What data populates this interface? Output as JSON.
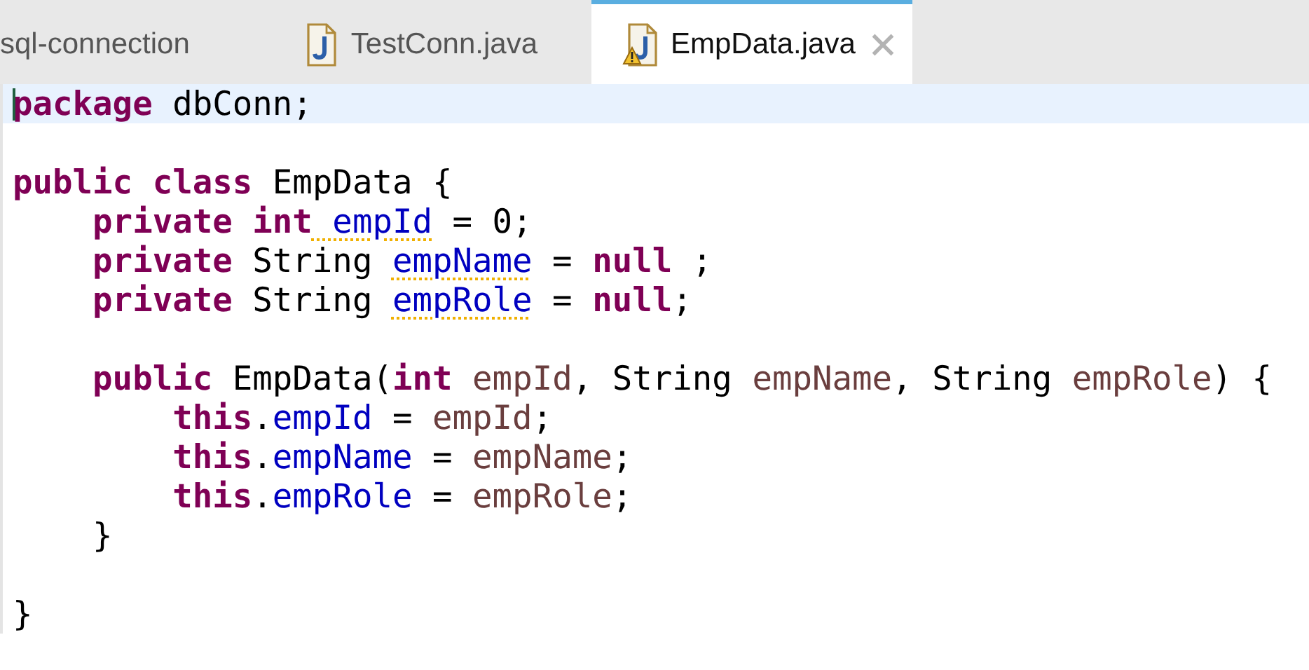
{
  "tabs": [
    {
      "label": "sql-connection",
      "kind": "project",
      "selected": false
    },
    {
      "label": "TestConn.java",
      "kind": "java",
      "selected": false,
      "warning": false
    },
    {
      "label": "EmpData.java",
      "kind": "java",
      "selected": true,
      "warning": true
    }
  ],
  "editor": {
    "lines": [
      {
        "current": true,
        "tokens": [
          {
            "text": "package",
            "kind": "keyword"
          },
          {
            "text": " dbConn;",
            "kind": "plain"
          }
        ]
      },
      {
        "current": false
      },
      {
        "current": false,
        "tokens": [
          {
            "text": "public",
            "kind": "keyword"
          },
          {
            "text": " class",
            "kind": "keyword"
          },
          {
            "text": " EmpData {",
            "kind": "plain"
          }
        ]
      },
      {
        "current": false,
        "tokens": [
          {
            "text": "    private",
            "kind": "keyword"
          },
          {
            "text": " int",
            "kind": "keyword"
          },
          {
            "text": " empId",
            "kind": "field",
            "warning": true
          },
          {
            "text": " = 0;",
            "kind": "plain"
          }
        ]
      },
      {
        "current": false,
        "tokens": [
          {
            "text": "    private",
            "kind": "keyword"
          },
          {
            "text": " String ",
            "kind": "plain"
          },
          {
            "text": "empName",
            "kind": "field",
            "warning": true
          },
          {
            "text": " = ",
            "kind": "plain"
          },
          {
            "text": "null",
            "kind": "keyword"
          },
          {
            "text": " ;",
            "kind": "plain"
          }
        ]
      },
      {
        "current": false,
        "tokens": [
          {
            "text": "    private",
            "kind": "keyword"
          },
          {
            "text": " String ",
            "kind": "plain"
          },
          {
            "text": "empRole",
            "kind": "field",
            "warning": true
          },
          {
            "text": " = ",
            "kind": "plain"
          },
          {
            "text": "null",
            "kind": "keyword"
          },
          {
            "text": ";",
            "kind": "plain"
          }
        ]
      },
      {
        "current": false
      },
      {
        "current": false,
        "tokens": [
          {
            "text": "    public",
            "kind": "keyword"
          },
          {
            "text": " EmpData(",
            "kind": "plain"
          },
          {
            "text": "int",
            "kind": "keyword"
          },
          {
            "text": " empId",
            "kind": "param"
          },
          {
            "text": ", String ",
            "kind": "plain"
          },
          {
            "text": "empName",
            "kind": "param"
          },
          {
            "text": ", String ",
            "kind": "plain"
          },
          {
            "text": "empRole",
            "kind": "param"
          },
          {
            "text": ") {",
            "kind": "plain"
          }
        ]
      },
      {
        "current": false,
        "tokens": [
          {
            "text": "        this",
            "kind": "keyword"
          },
          {
            "text": ".",
            "kind": "plain"
          },
          {
            "text": "empId",
            "kind": "field",
            "warning": false
          },
          {
            "text": " = ",
            "kind": "plain"
          },
          {
            "text": "empId",
            "kind": "param"
          },
          {
            "text": ";",
            "kind": "plain"
          }
        ]
      },
      {
        "current": false,
        "tokens": [
          {
            "text": "        this",
            "kind": "keyword"
          },
          {
            "text": ".",
            "kind": "plain"
          },
          {
            "text": "empName",
            "kind": "field",
            "warning": false
          },
          {
            "text": " = ",
            "kind": "plain"
          },
          {
            "text": "empName",
            "kind": "param"
          },
          {
            "text": ";",
            "kind": "plain"
          }
        ]
      },
      {
        "current": false,
        "tokens": [
          {
            "text": "        this",
            "kind": "keyword"
          },
          {
            "text": ".",
            "kind": "plain"
          },
          {
            "text": "empRole",
            "kind": "field",
            "warning": false
          },
          {
            "text": " = ",
            "kind": "plain"
          },
          {
            "text": "empRole",
            "kind": "param"
          },
          {
            "text": ";",
            "kind": "plain"
          }
        ]
      },
      {
        "current": false,
        "tokens": [
          {
            "text": "    }",
            "kind": "plain"
          }
        ]
      },
      {
        "current": false
      },
      {
        "current": false,
        "tokens": [
          {
            "text": "}",
            "kind": "plain"
          }
        ]
      }
    ]
  }
}
